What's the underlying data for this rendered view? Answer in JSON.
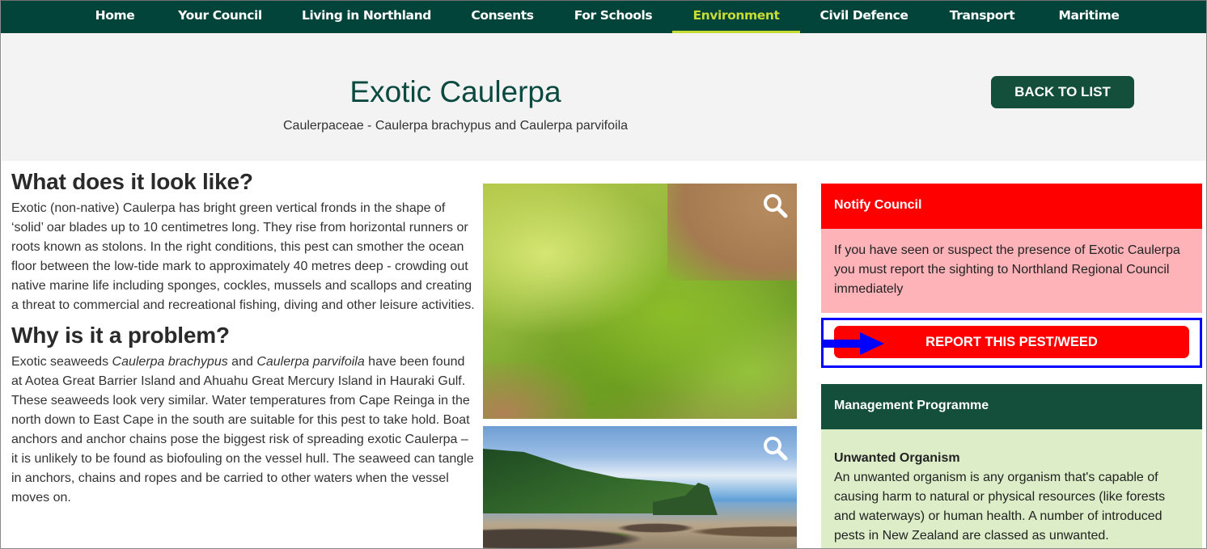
{
  "nav": {
    "items": [
      {
        "label": "Home",
        "active": false
      },
      {
        "label": "Your Council",
        "active": false
      },
      {
        "label": "Living in Northland",
        "active": false
      },
      {
        "label": "Consents",
        "active": false
      },
      {
        "label": "For Schools",
        "active": false
      },
      {
        "label": "Environment",
        "active": true
      },
      {
        "label": "Civil Defence",
        "active": false
      },
      {
        "label": "Transport",
        "active": false
      },
      {
        "label": "Maritime",
        "active": false
      }
    ]
  },
  "hero": {
    "title": "Exotic Caulerpa",
    "subtitle": "Caulerpaceae - Caulerpa brachypus and Caulerpa parvifoila",
    "back_button": "BACK TO LIST"
  },
  "content": {
    "section1": {
      "heading": "What does it look like?",
      "body": "Exotic (non-native) Caulerpa has bright green vertical fronds in the shape of ‘solid’ oar blades up to 10 centimetres long. They rise from horizontal runners or roots known as stolons. In the right conditions, this pest can smother the ocean floor between the low-tide mark to approximately 40 metres deep - crowding out native marine life including sponges, cockles, mussels and scallops and creating a threat to commercial and recreational fishing, diving and other leisure activities."
    },
    "section2": {
      "heading": "Why is it a problem?",
      "body_part1": "Exotic seaweeds ",
      "italic1": "Caulerpa brachypus",
      "body_part2": " and ",
      "italic2": "Caulerpa parvifoila",
      "body_part3": " have been found at Aotea Great Barrier Island and Ahuahu Great Mercury Island in Hauraki Gulf. These seaweeds look very similar. Water temperatures from Cape Reinga in the north down to East Cape in the south are suitable for this pest to take hold. Boat anchors and anchor chains pose the biggest risk of spreading exotic Caulerpa – it is unlikely to be found as biofouling on the vessel hull. The seaweed can tangle in anchors, chains and ropes and be carried to other waters when the vessel moves on."
    }
  },
  "images": [
    {
      "subject": "close-up of green caulerpa seaweed on sand",
      "icon": "zoom-magnifier-icon"
    },
    {
      "subject": "coastal beach with rocks and green hills",
      "icon": "zoom-magnifier-icon"
    }
  ],
  "sidebar": {
    "notify": {
      "heading": "Notify Council",
      "body": "If you have seen or suspect the presence of Exotic Caulerpa you must report the sighting to Northland Regional Council immediately"
    },
    "report_button": "REPORT THIS PEST/WEED",
    "management": {
      "heading": "Management Programme",
      "subheading": "Unwanted Organism",
      "body": "An unwanted organism is any organism that's capable of causing harm to natural or physical resources (like forests and waterways) or human health. A number of introduced pests in New Zealand are classed as unwanted."
    }
  },
  "colors": {
    "nav_bg": "#03443a",
    "nav_active": "#c7dc35",
    "brand_green": "#134f3a",
    "alert_red": "#ff0000",
    "alert_pink": "#feb3b9",
    "info_green": "#dcedc8",
    "annotation_blue": "#0000ff"
  }
}
